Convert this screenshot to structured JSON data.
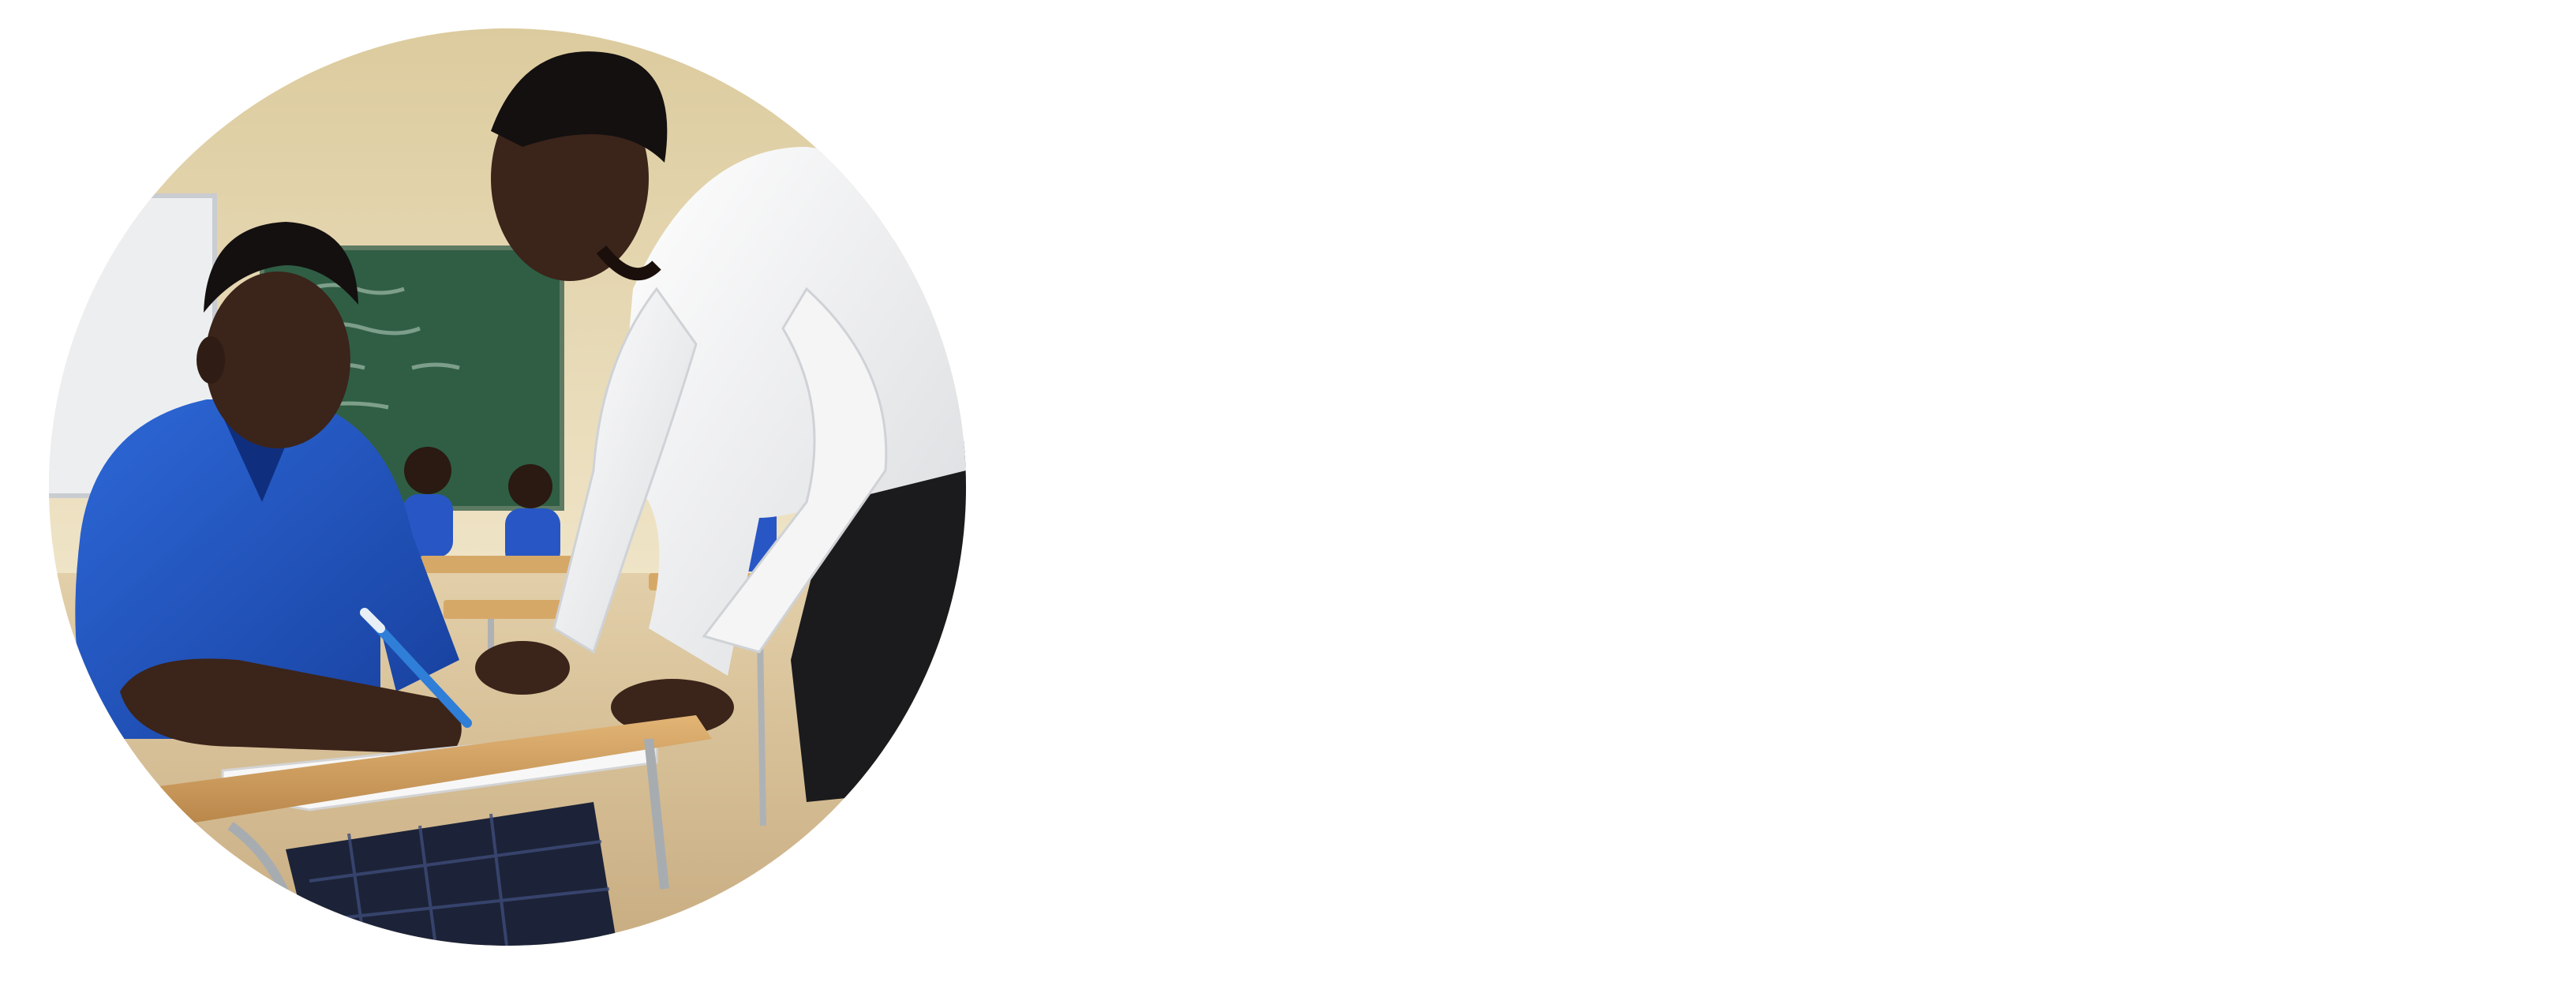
{
  "scene": {
    "subject": "classroom-photo",
    "shape": "circle",
    "background": "#ffffff"
  },
  "colors": {
    "wall": "#e8d9b0",
    "chalkboard": "#2f5e45",
    "whiteboard": "#eceef0",
    "student_shirt": "#1f55c4",
    "teacher_shirt": "#f1f1f1",
    "teacher_trousers": "#1b1b1d",
    "desk_top": "#d9a866",
    "skin": "#3b241a",
    "floor": "#d6bf9a"
  }
}
